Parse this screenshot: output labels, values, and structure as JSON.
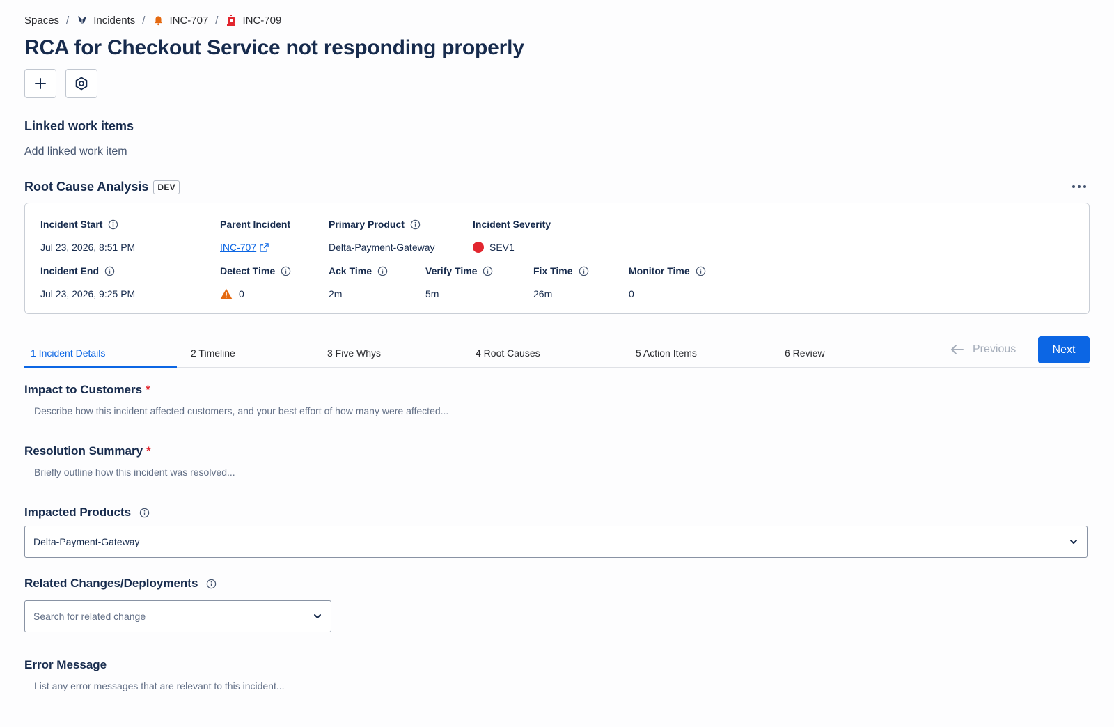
{
  "breadcrumb": {
    "spaces": "Spaces",
    "incidents": "Incidents",
    "parent": "INC-707",
    "current": "INC-709"
  },
  "page": {
    "title": "RCA for Checkout Service not responding properly",
    "linked_title": "Linked work items",
    "add_linked": "Add linked work item"
  },
  "rca": {
    "title": "Root Cause Analysis",
    "badge": "DEV",
    "labels": {
      "incident_start": "Incident Start",
      "parent_incident": "Parent Incident",
      "primary_product": "Primary Product",
      "incident_severity": "Incident Severity",
      "incident_end": "Incident End",
      "detect_time": "Detect Time",
      "ack_time": "Ack Time",
      "verify_time": "Verify Time",
      "fix_time": "Fix Time",
      "monitor_time": "Monitor Time"
    },
    "values": {
      "incident_start": "Jul 23, 2026, 8:51 PM",
      "parent_incident": "INC-707",
      "primary_product": "Delta-Payment-Gateway",
      "incident_severity": "SEV1",
      "incident_end": "Jul 23, 2026, 9:25 PM",
      "detect_time": "0",
      "ack_time": "2m",
      "verify_time": "5m",
      "fix_time": "26m",
      "monitor_time": "0"
    },
    "severity_color": "#e2262f"
  },
  "tabs": [
    {
      "label": "1 Incident Details"
    },
    {
      "label": "2 Timeline"
    },
    {
      "label": "3 Five Whys"
    },
    {
      "label": "4 Root Causes"
    },
    {
      "label": "5 Action Items"
    },
    {
      "label": "6 Review"
    }
  ],
  "nav": {
    "previous": "Previous",
    "next": "Next"
  },
  "form": {
    "impact_label": "Impact to Customers",
    "impact_placeholder": "Describe how this incident affected customers, and your best effort of how many were affected...",
    "resolution_label": "Resolution Summary",
    "resolution_placeholder": "Briefly outline how this incident was resolved...",
    "required_mark": "*",
    "impacted_label": "Impacted Products",
    "impacted_value": "Delta-Payment-Gateway",
    "related_label": "Related Changes/Deployments",
    "related_placeholder": "Search for related change",
    "error_label": "Error Message",
    "error_placeholder": "List any error messages that are relevant to this incident..."
  },
  "colors": {
    "accent": "#0c66e4",
    "required": "#e2262f",
    "warning": "#e56910"
  }
}
